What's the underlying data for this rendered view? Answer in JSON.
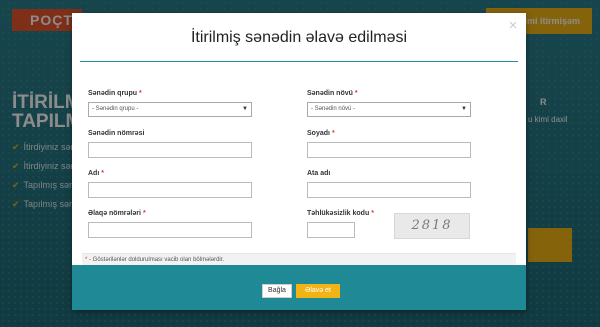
{
  "background": {
    "logo_text": "POÇT",
    "top_button": "ddmi itirmişəm",
    "title_line1": "İTİRİLM",
    "title_line2": "TAPILM",
    "list": [
      "İtirdiyiniz sən",
      "İtirdiyiniz sən",
      "Tapılmış sən",
      "Tapılmış sən"
    ],
    "right_letter": "R",
    "right_text": "u kimi daxil"
  },
  "modal": {
    "title": "İtirilmiş sənədin əlavə edilməsi",
    "close_symbol": "×",
    "fields": {
      "doc_group": {
        "label": "Sənədin qrupu",
        "required": "*",
        "value": "- Sənədin qrupu -"
      },
      "doc_type": {
        "label": "Sənədin növü",
        "required": "*",
        "value": "- Sənədin növü -"
      },
      "doc_number": {
        "label": "Sənədin nömrəsi",
        "value": ""
      },
      "surname": {
        "label": "Soyadı",
        "required": "*",
        "value": ""
      },
      "name": {
        "label": "Adı",
        "required": "*",
        "value": ""
      },
      "father_name": {
        "label": "Ata adı",
        "value": ""
      },
      "phone": {
        "label": "Əlaqə nömrələri",
        "required": "*",
        "value": ""
      },
      "security_code": {
        "label": "Təhlükəsizlik kodu",
        "required": "*",
        "value": "",
        "captcha_text": "2818"
      }
    },
    "note_star": "*",
    "note_text": "- Göstərilənlər doldurulması vacib olan bölmələrdir."
  },
  "footer": {
    "close_label": "Bağla",
    "add_label": "Əlavə et"
  },
  "colors": {
    "teal": "#1f8a96",
    "yellow": "#f2b415",
    "required_red": "#e3342f"
  }
}
